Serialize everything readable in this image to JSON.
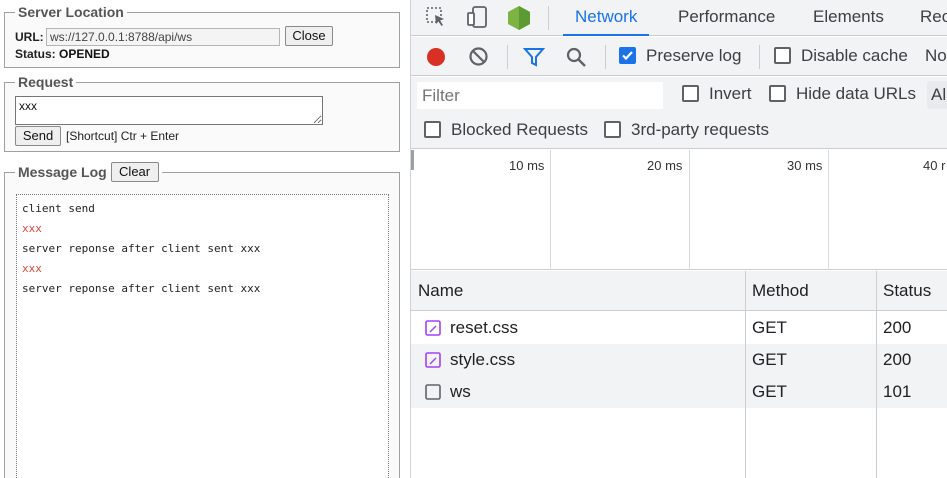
{
  "app": {
    "server_location": {
      "legend": "Server Location",
      "url_label": "URL:",
      "url_value": "ws://127.0.0.1:8788/api/ws",
      "close_label": "Close",
      "status_label": "Status:",
      "status_value": "OPENED"
    },
    "request": {
      "legend": "Request",
      "input_value": "xxx",
      "send_label": "Send",
      "shortcut_hint": "[Shortcut] Ctr + Enter"
    },
    "message_log": {
      "legend": "Message Log",
      "clear_label": "Clear",
      "lines": [
        {
          "text": "client send",
          "color": "#222222"
        },
        {
          "text": "xxx",
          "color": "#e0473a"
        },
        {
          "text": "server reponse after client sent xxx",
          "color": "#222222"
        },
        {
          "text": "xxx",
          "color": "#e0473a"
        },
        {
          "text": "server reponse after client sent xxx",
          "color": "#222222"
        }
      ]
    }
  },
  "devtools": {
    "tabs": [
      {
        "label": "Network",
        "active": true
      },
      {
        "label": "Performance",
        "active": false
      },
      {
        "label": "Elements",
        "active": false
      },
      {
        "label": "Rec",
        "active": false
      }
    ],
    "toolbar": {
      "preserve_log_label": "Preserve log",
      "preserve_log_checked": true,
      "disable_cache_label": "Disable cache",
      "throttle_partial": "No"
    },
    "filter": {
      "placeholder": "Filter",
      "invert_label": "Invert",
      "hide_data_urls_label": "Hide data URLs",
      "all_chip": "Al",
      "blocked_requests_label": "Blocked Requests",
      "third_party_label": "3rd-party requests"
    },
    "timeline": {
      "ticks": [
        "10 ms",
        "20 ms",
        "30 ms",
        "40 r"
      ]
    },
    "table": {
      "columns": [
        "Name",
        "Method",
        "Status"
      ],
      "rows": [
        {
          "name": "reset.css",
          "method": "GET",
          "status": "200",
          "icon": "css-file-icon"
        },
        {
          "name": "style.css",
          "method": "GET",
          "status": "200",
          "icon": "css-file-icon"
        },
        {
          "name": "ws",
          "method": "GET",
          "status": "101",
          "icon": "websocket-file-icon"
        }
      ]
    },
    "colors": {
      "accent": "#1a73e8",
      "record": "#d93025",
      "css_icon": "#a142f4"
    }
  }
}
